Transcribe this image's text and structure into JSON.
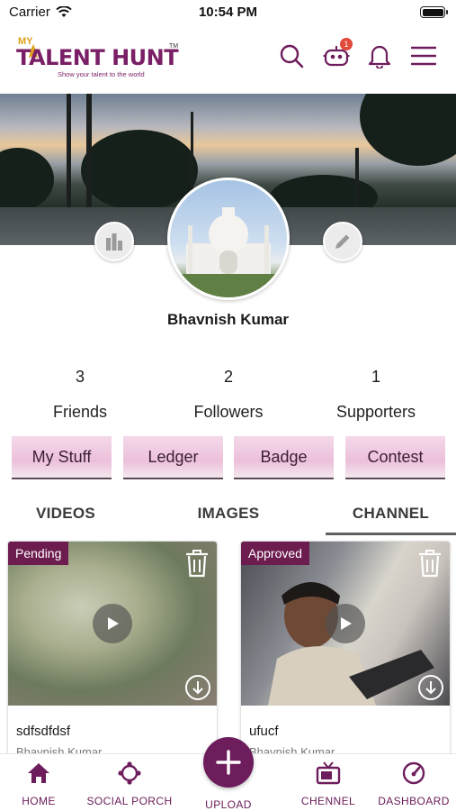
{
  "status_bar": {
    "carrier": "Carrier",
    "time": "10:54 PM"
  },
  "header": {
    "logo": {
      "prefix": "MY",
      "brand": "TALENT HUNT",
      "trademark": "TM",
      "tagline": "Show your talent to the world"
    },
    "notification_count": "1"
  },
  "profile": {
    "name": "Bhavnish Kumar",
    "stats": [
      {
        "value": "3",
        "label": "Friends"
      },
      {
        "value": "2",
        "label": "Followers"
      },
      {
        "value": "1",
        "label": "Supporters"
      }
    ],
    "pills": [
      "My Stuff",
      "Ledger",
      "Badge",
      "Contest"
    ]
  },
  "tabs": [
    {
      "label": "VIDEOS",
      "active": false
    },
    {
      "label": "IMAGES",
      "active": false
    },
    {
      "label": "CHANNEL",
      "active": true
    }
  ],
  "cards": [
    {
      "status": "Pending",
      "title": "sdfsdfdsf",
      "author": "Bhavnish Kumar"
    },
    {
      "status": "Approved",
      "title": "ufucf",
      "author": "Bhavnish Kumar"
    }
  ],
  "bottom_nav": {
    "home": "HOME",
    "social_porch": "SOCIAL PORCH",
    "upload": "UPLOAD",
    "chennel": "CHENNEL",
    "dashboard": "DASHBOARD"
  },
  "colors": {
    "brand": "#6d1c5c",
    "accent": "#e0a21a",
    "pill": "#ecc0da",
    "badge": "#e24a3b"
  }
}
